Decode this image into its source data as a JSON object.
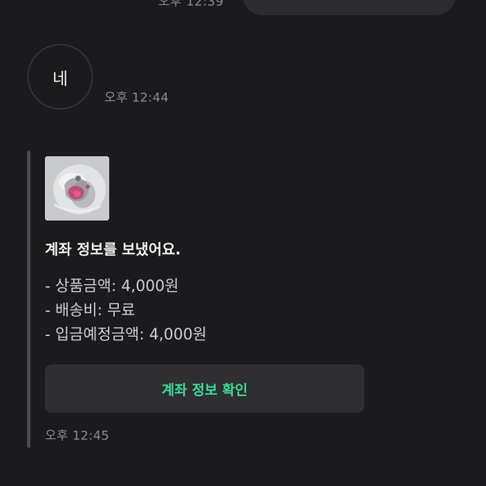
{
  "previous_message": {
    "time": "오후 12:39"
  },
  "reply_message": {
    "text": "네",
    "time": "오후 12:44"
  },
  "account_card": {
    "title": "계좌 정보를 보냈어요.",
    "lines": [
      "- 상품금액: 4,000원",
      "- 배송비: 무료",
      "- 입금예정금액: 4,000원"
    ],
    "button_label": "계좌 정보 확인",
    "time": "오후 12:45"
  },
  "colors": {
    "background": "#1b1b1d",
    "bubble": "#2c2c2e",
    "button": "#2f2f31",
    "accent": "#3ddc9a",
    "muted_text": "#8a8a8e"
  }
}
